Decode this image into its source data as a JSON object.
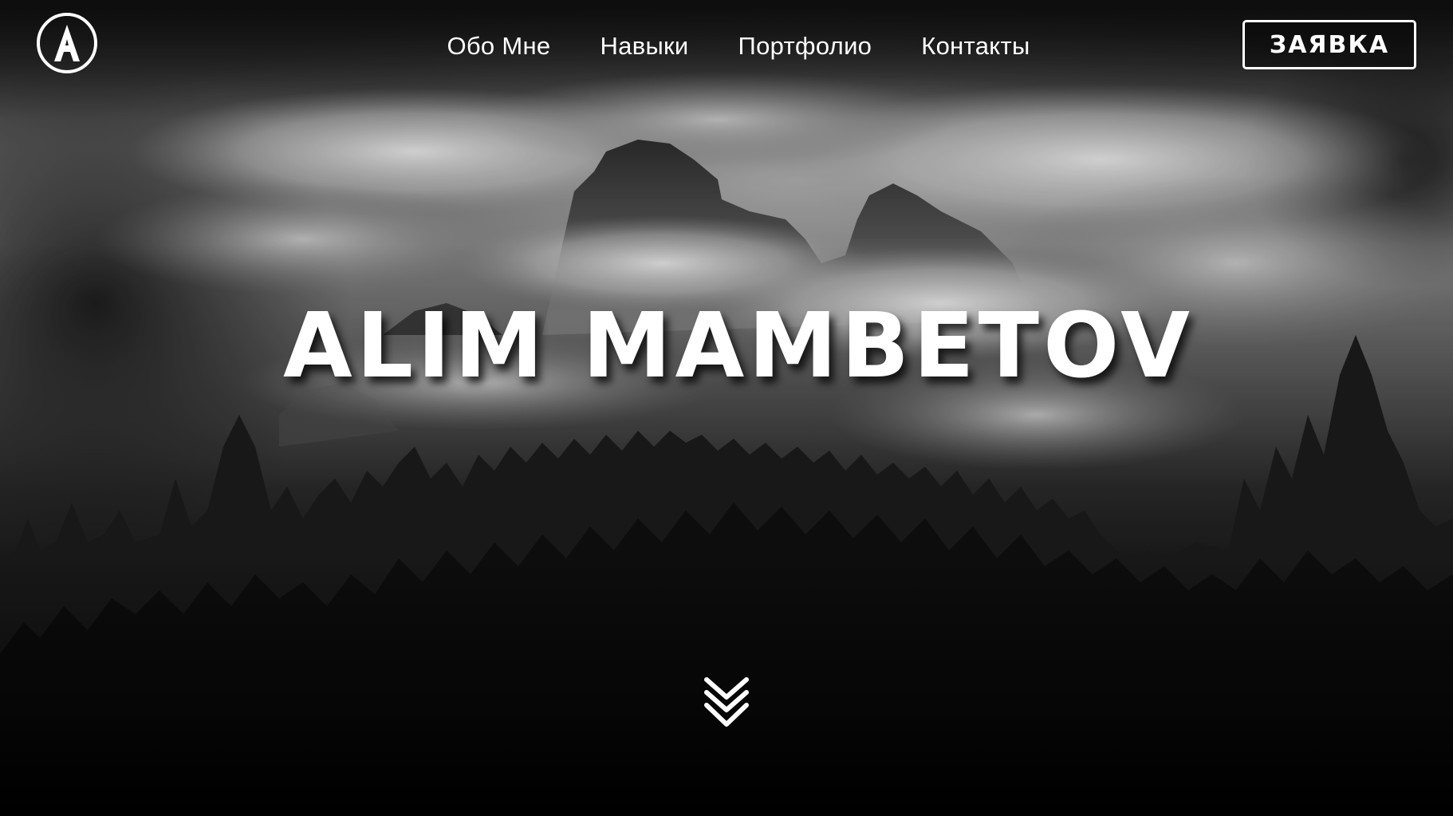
{
  "header": {
    "logo_icon": "letter-a-logo-icon",
    "nav": [
      {
        "label": "Обо Мне"
      },
      {
        "label": "Навыки"
      },
      {
        "label": "Портфолио"
      },
      {
        "label": "Контакты"
      }
    ],
    "cta_label": "ЗАЯВКА"
  },
  "hero": {
    "title": "ALIM MAMBETOV",
    "background": "mountain-forest-clouds-photo",
    "scroll_icon": "double-chevron-down-icon"
  },
  "colors": {
    "text": "#ffffff",
    "background": "#000000"
  }
}
